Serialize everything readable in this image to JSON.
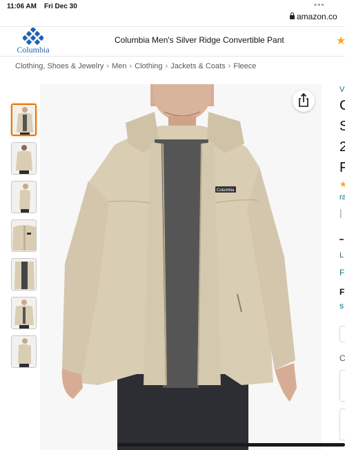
{
  "status_bar": {
    "time": "11:06 AM",
    "date": "Fri Dec 30",
    "url": "amazon.co"
  },
  "brand_bar": {
    "logo_text": "Columbia",
    "product_title": "Columbia Men's Silver Ridge Convertible Pant"
  },
  "breadcrumb": [
    "Clothing, Shoes & Jewelry",
    "Men",
    "Clothing",
    "Jackets & Coats",
    "Fleece"
  ],
  "gallery": {
    "thumbnail_count": 7,
    "selected_thumbnail": 1,
    "jacket_label": "Columbia"
  },
  "right_column_fragments": [
    "V",
    "C",
    "S",
    "2",
    "F",
    "ra",
    "L",
    "F",
    "F",
    "s",
    "C"
  ],
  "colors": {
    "jacket": "#d9cdb4",
    "shirt": "#555555",
    "pants": "#2c2e33",
    "link": "#007185",
    "accent": "#e77600",
    "price_red": "#cc0c39",
    "brand_blue": "#1e63b0"
  }
}
